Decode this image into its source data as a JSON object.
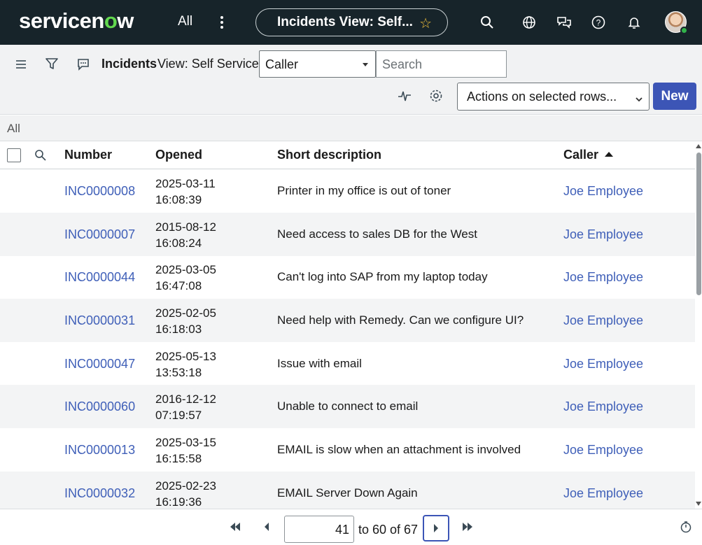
{
  "header": {
    "logo_main": "servicen",
    "logo_o": "o",
    "logo_end": "w",
    "all_label": "All",
    "context_title": "Incidents View: Self...",
    "icons": [
      "search-icon",
      "globe-icon",
      "chat-icon",
      "help-icon",
      "bell-icon"
    ]
  },
  "toolbar": {
    "list_title": "Incidents",
    "view_label": "View: Self Service",
    "search_field": "Caller",
    "search_placeholder": "Search",
    "actions_label": "Actions on selected rows...",
    "new_label": "New"
  },
  "breadcrumb": "All",
  "columns": {
    "number": "Number",
    "opened": "Opened",
    "short_description": "Short description",
    "caller": "Caller"
  },
  "rows": [
    {
      "number": "INC0000008",
      "date": "2025-03-11",
      "time": "16:08:39",
      "description": "Printer in my office is out of toner",
      "caller": "Joe Employee"
    },
    {
      "number": "INC0000007",
      "date": "2015-08-12",
      "time": "16:08:24",
      "description": "Need access to sales DB for the West",
      "caller": "Joe Employee"
    },
    {
      "number": "INC0000044",
      "date": "2025-03-05",
      "time": "16:47:08",
      "description": "Can't log into SAP from my laptop today",
      "caller": "Joe Employee"
    },
    {
      "number": "INC0000031",
      "date": "2025-02-05",
      "time": "16:18:03",
      "description": "Need help with Remedy. Can we configure UI?",
      "caller": "Joe Employee"
    },
    {
      "number": "INC0000047",
      "date": "2025-05-13",
      "time": "13:53:18",
      "description": "Issue with email",
      "caller": "Joe Employee"
    },
    {
      "number": "INC0000060",
      "date": "2016-12-12",
      "time": "07:19:57",
      "description": "Unable to connect to email",
      "caller": "Joe Employee"
    },
    {
      "number": "INC0000013",
      "date": "2025-03-15",
      "time": "16:15:58",
      "description": "EMAIL is slow when an attachment is involved",
      "caller": "Joe Employee"
    },
    {
      "number": "INC0000032",
      "date": "2025-02-23",
      "time": "16:19:36",
      "description": "EMAIL Server Down Again",
      "caller": "Joe Employee"
    }
  ],
  "pagination": {
    "current": "41",
    "range_text": "to 60 of 67"
  },
  "colors": {
    "header_bg": "#17242a",
    "accent": "#3c55b6",
    "link": "#3f5fb8",
    "logo_green": "#62d84e"
  }
}
